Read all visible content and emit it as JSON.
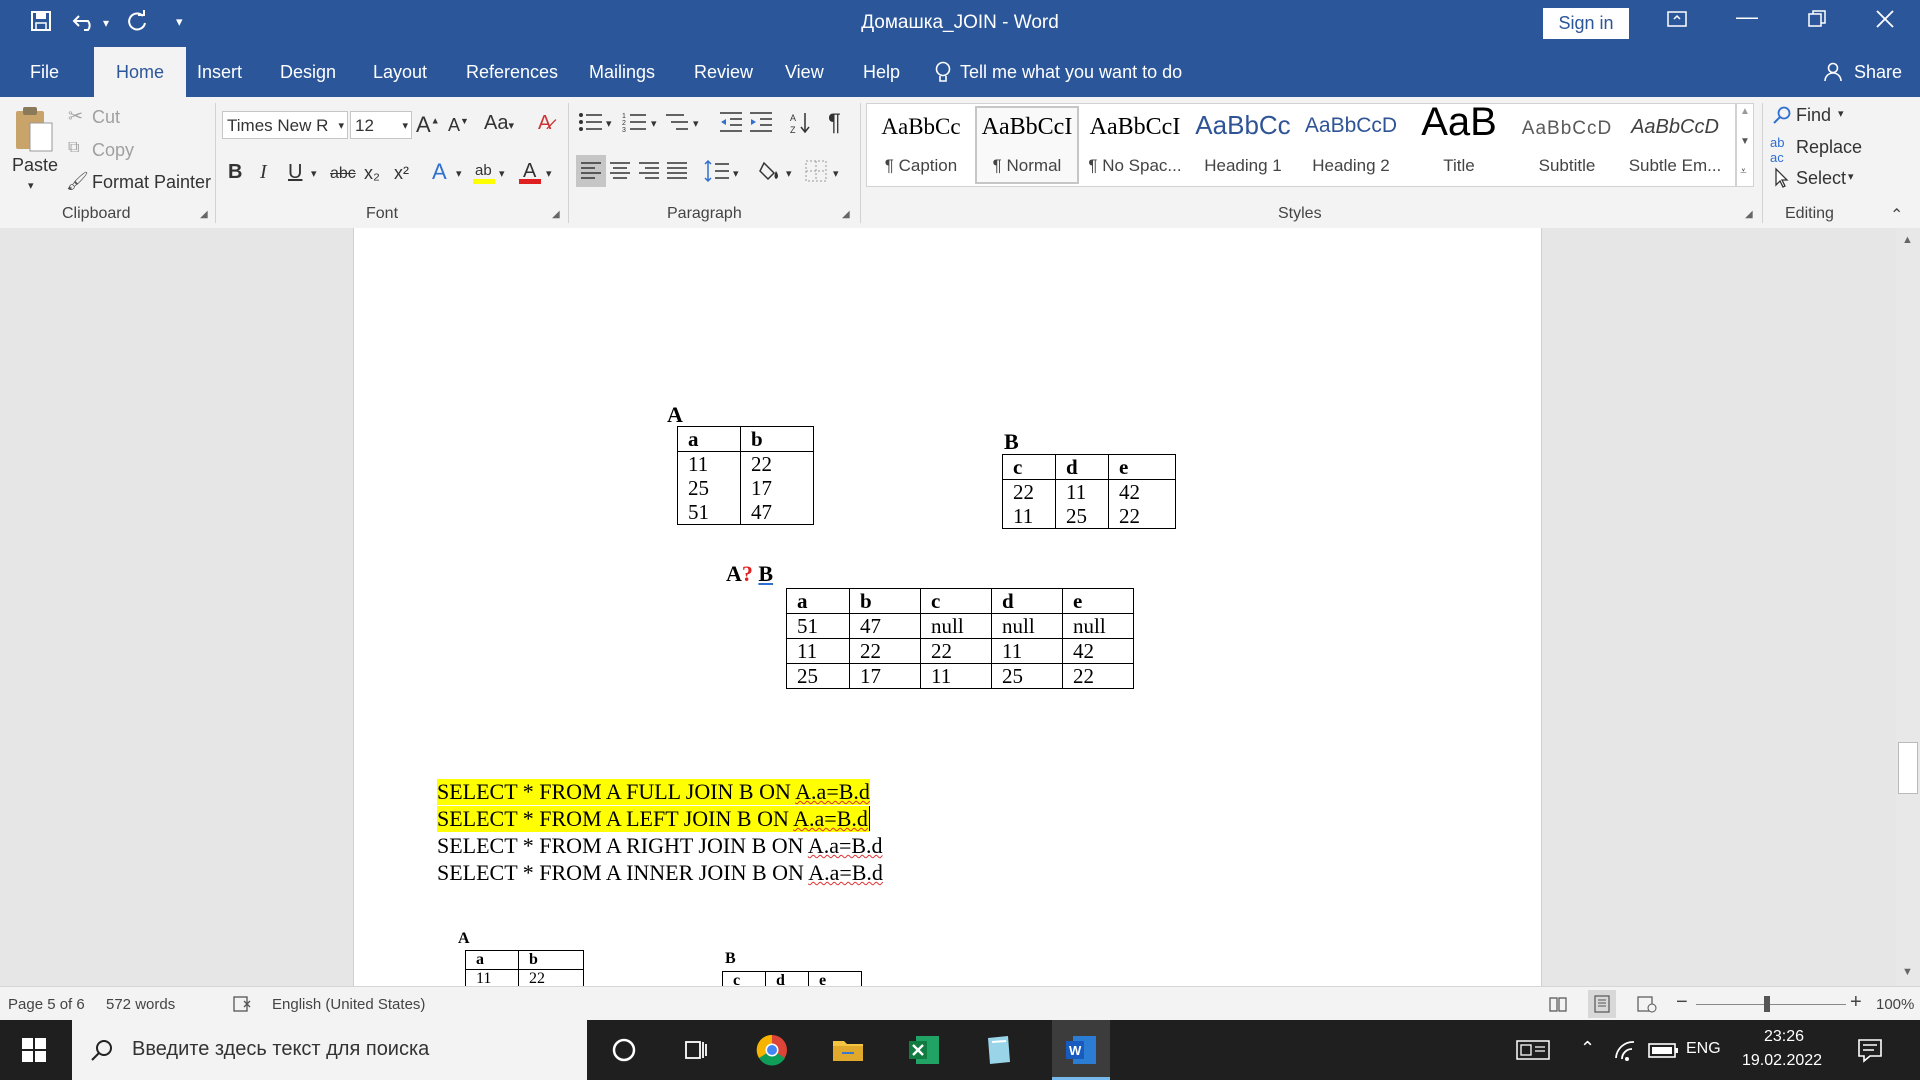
{
  "window": {
    "title": "Домашка_JOIN  -  Word",
    "sign_in": "Sign in",
    "share": "Share"
  },
  "tabs": [
    "File",
    "Home",
    "Insert",
    "Design",
    "Layout",
    "References",
    "Mailings",
    "Review",
    "View",
    "Help"
  ],
  "tell_me": "Tell me what you want to do",
  "clipboard": {
    "paste": "Paste",
    "cut": "Cut",
    "copy": "Copy",
    "format_painter": "Format Painter",
    "label": "Clipboard"
  },
  "font": {
    "family": "Times New R",
    "size": "12",
    "label": "Font",
    "case_label": "Aa",
    "bold": "B",
    "italic": "I",
    "underline": "U",
    "strike": "abc",
    "sub": "x₂",
    "sup": "x²"
  },
  "paragraph": {
    "label": "Paragraph"
  },
  "styles": {
    "label": "Styles",
    "items": [
      {
        "sample": "AaBbCc",
        "name": "¶ Caption"
      },
      {
        "sample": "AaBbCcI",
        "name": "¶ Normal"
      },
      {
        "sample": "AaBbCcI",
        "name": "¶ No Spac..."
      },
      {
        "sample": "AaBbCc",
        "name": "Heading 1"
      },
      {
        "sample": "AaBbCcD",
        "name": "Heading 2"
      },
      {
        "sample": "AaB",
        "name": "Title"
      },
      {
        "sample": "AaBbCcD",
        "name": "Subtitle"
      },
      {
        "sample": "AaBbCcD",
        "name": "Subtle Em..."
      }
    ],
    "selected_index": 1,
    "colors": {
      "heading": "#2f5496",
      "subtitle": "#5a5a5a"
    }
  },
  "editing": {
    "label": "Editing",
    "find": "Find",
    "replace": "Replace",
    "select": "Select"
  },
  "document": {
    "tableA": {
      "title": "A",
      "headers": [
        "a",
        "b"
      ],
      "rows": [
        [
          "11",
          "22"
        ],
        [
          "25",
          "17"
        ],
        [
          "51",
          "47"
        ]
      ]
    },
    "tableB": {
      "title": "B",
      "headers": [
        "c",
        "d",
        "e"
      ],
      "rows": [
        [
          "22",
          "11",
          "42"
        ],
        [
          "11",
          "25",
          "22"
        ]
      ]
    },
    "join_title": {
      "a": "A",
      "q": "?",
      "b": "B"
    },
    "result": {
      "headers": [
        "a",
        "b",
        "c",
        "d",
        "e"
      ],
      "rows": [
        [
          "51",
          "47",
          "null",
          "null",
          "null"
        ],
        [
          "11",
          "22",
          "22",
          "11",
          "42"
        ],
        [
          "25",
          "17",
          "11",
          "25",
          "22"
        ]
      ]
    },
    "sql": [
      {
        "prefix": "SELECT * FROM A FULL JOIN B ON ",
        "cond": "A.a=B.d",
        "highlight": true
      },
      {
        "prefix": "SELECT * FROM A LEFT JOIN B ON ",
        "cond": "A.a=B.d",
        "highlight": true
      },
      {
        "prefix": "SELECT * FROM A RIGHT JOIN B ON ",
        "cond": "A.a=B.d",
        "highlight": false
      },
      {
        "prefix": "SELECT * FROM A INNER JOIN B ON ",
        "cond": "A.a=B.d",
        "highlight": false
      }
    ],
    "small_tableA": {
      "title": "A",
      "headers": [
        "a",
        "b"
      ],
      "row": [
        "11",
        "22"
      ]
    },
    "small_tableB": {
      "title": "B",
      "headers": [
        "c",
        "d",
        "e"
      ]
    }
  },
  "status": {
    "page": "Page 5 of 6",
    "words": "572 words",
    "language": "English (United States)",
    "zoom": "100%"
  },
  "taskbar": {
    "search_placeholder": "Введите здесь текст для поиска",
    "lang": "ENG",
    "time": "23:26",
    "date": "19.02.2022"
  }
}
